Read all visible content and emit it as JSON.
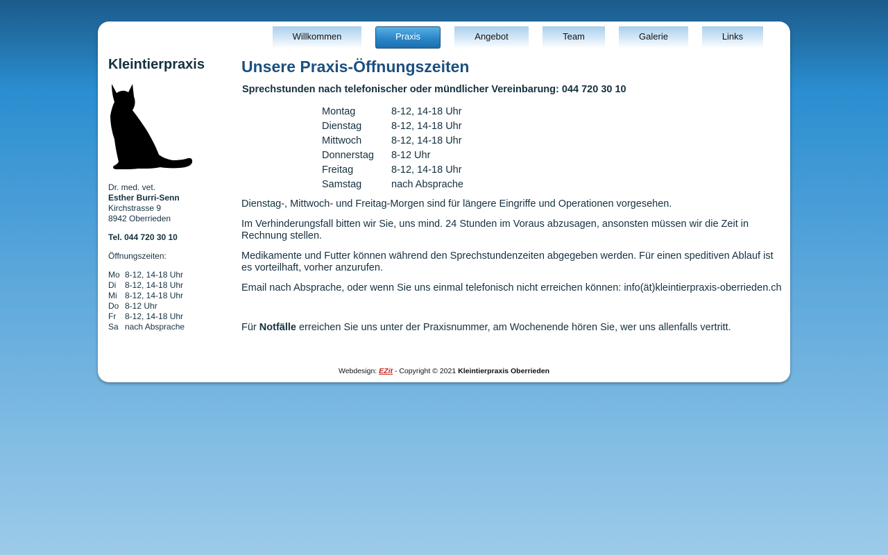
{
  "nav": {
    "items": [
      {
        "label": "Willkommen",
        "active": false
      },
      {
        "label": "Praxis",
        "active": true
      },
      {
        "label": "Angebot",
        "active": false
      },
      {
        "label": "Team",
        "active": false
      },
      {
        "label": "Galerie",
        "active": false
      },
      {
        "label": "Links",
        "active": false
      }
    ]
  },
  "sidebar": {
    "title": "Kleintierpraxis",
    "logo_icon": "sitting-cat-silhouette",
    "doctor_title": "Dr. med. vet.",
    "doctor_name": "Esther Burri-Senn",
    "street": "Kirchstrasse 9",
    "city": "8942 Oberrieden",
    "phone": "Tel. 044 720 30 10",
    "hours_label": "Öffnungszeiten:",
    "hours": [
      {
        "day": "Mo",
        "time": "8-12, 14-18 Uhr"
      },
      {
        "day": "Di",
        "time": "8-12, 14-18 Uhr"
      },
      {
        "day": "Mi",
        "time": "8-12, 14-18 Uhr"
      },
      {
        "day": "Do",
        "time": "8-12 Uhr"
      },
      {
        "day": "Fr",
        "time": "8-12, 14-18 Uhr"
      },
      {
        "day": "Sa",
        "time": "nach Absprache"
      }
    ]
  },
  "main": {
    "title": "Unsere Praxis-Öffnungszeiten",
    "subhead": "Sprechstunden nach telefonischer oder mündlicher Vereinbarung: 044 720 30 10",
    "schedule": [
      {
        "day": "Montag",
        "time": "8-12, 14-18 Uhr"
      },
      {
        "day": "Dienstag",
        "time": "8-12, 14-18 Uhr"
      },
      {
        "day": "Mittwoch",
        "time": "8-12, 14-18 Uhr"
      },
      {
        "day": "Donnerstag",
        "time": "8-12 Uhr"
      },
      {
        "day": "Freitag",
        "time": "8-12, 14-18 Uhr"
      },
      {
        "day": "Samstag",
        "time": "nach Absprache"
      }
    ],
    "paragraphs": [
      "Dienstag-, Mittwoch- und Freitag-Morgen sind für längere Eingriffe und Operationen vorgesehen.",
      "Im Verhinderungsfall bitten wir Sie, uns mind. 24 Stunden im Voraus abzusagen, ansonsten müssen wir die Zeit in Rechnung stellen.",
      "Medikamente und Futter können während den Sprechstundenzeiten abgegeben werden. Für einen speditiven Ablauf ist es vorteilhaft, vorher anzurufen.",
      "Email nach Absprache, oder wenn Sie uns einmal telefonisch nicht erreichen können: info(ät)kleintierpraxis-oberrieden.ch"
    ],
    "emergency": {
      "prefix": "Für ",
      "bold": "Notfälle",
      "suffix": " erreichen Sie uns unter der Praxisnummer, am Wochenende hören Sie, wer uns allenfalls vertritt."
    }
  },
  "footer": {
    "prefix": "Webdesign: ",
    "brand": "EZit",
    "middle": " - Copyright © 2021 ",
    "owner": "Kleintierpraxis Oberrieden"
  },
  "colors": {
    "heading": "#1c4f7f",
    "text": "#14303f",
    "active_tab": "#2b86c8",
    "brand": "#c0281e"
  }
}
